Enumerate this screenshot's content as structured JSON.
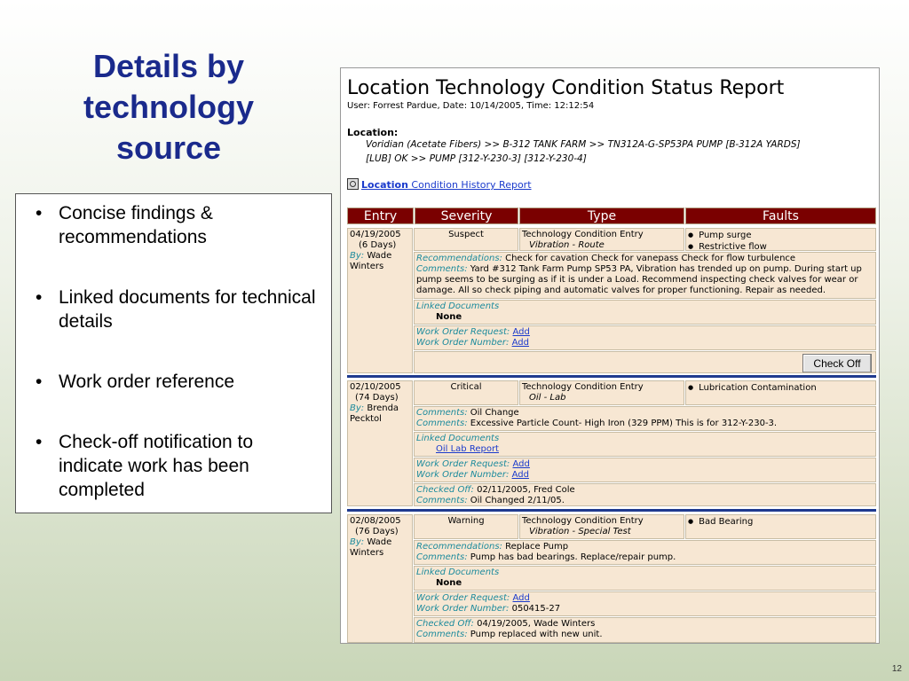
{
  "slide": {
    "title": "Details by technology source",
    "bullets": [
      "Concise findings & recommendations",
      "Linked documents for technical details",
      "Work order reference",
      "Check-off notification to indicate work has been completed"
    ],
    "bullet_symbol": "•",
    "page_number": "12"
  },
  "report": {
    "title": "Location Technology Condition Status Report",
    "user_line": "User: Forrest Pardue, Date: 10/14/2005, Time: 12:12:54",
    "location_label": "Location:",
    "location_line1": "Voridian (Acetate Fibers) >> B-312 TANK FARM >> TN312A-G-SP53PA PUMP [B-312A YARDS]",
    "location_line2": "[LUB] OK >> PUMP [312-Y-230-3] [312-Y-230-4]",
    "history_link_bold": "Location",
    "history_link_rest": " Condition History Report ",
    "headers": {
      "entry": "Entry",
      "severity": "Severity",
      "type": "Type",
      "faults": "Faults"
    },
    "labels": {
      "by": "By:",
      "recommendations": "Recommendations:",
      "comments": "Comments:",
      "linked_documents": "Linked Documents",
      "work_order_request": "Work Order Request:",
      "work_order_number": "Work Order Number:",
      "checked_off": "Checked Off:"
    },
    "check_off_button": "Check Off",
    "entries": [
      {
        "date": "04/19/2005",
        "age": "(6 Days)",
        "by_first": "Wade",
        "by_last": "Winters",
        "severity": "Suspect",
        "type": "Technology Condition Entry",
        "subtype": "Vibration - Route",
        "faults": [
          "Pump surge",
          "Restrictive flow"
        ],
        "recommendations": "Check for cavation Check for vanepass Check for flow turbulence",
        "comments": "Yard #312 Tank Farm Pump SP53 PA, Vibration has trended up on pump. During start up pump seems to be surging as if it is under a Load. Recommend inspecting check valves for wear or damage. All so check piping and automatic valves for proper functioning. Repair as needed.",
        "linked_document": "None",
        "work_order_request": "Add",
        "work_order_number": "Add"
      },
      {
        "date": "02/10/2005",
        "age": "(74 Days)",
        "by_first": "Brenda",
        "by_last": "Pecktol",
        "severity": "Critical",
        "type": "Technology Condition Entry",
        "subtype": "Oil - Lab",
        "faults": [
          "Lubrication Contamination"
        ],
        "recommendations": "Oil Change",
        "comments": "Excessive Particle Count- High Iron (329 PPM) This is for 312-Y-230-3.",
        "linked_document": "Oil Lab Report",
        "work_order_request": "Add",
        "work_order_number": "Add",
        "checked_off": "02/11/2005, Fred Cole",
        "checkoff_comments": "Oil Changed 2/11/05."
      },
      {
        "date": "02/08/2005",
        "age": "(76 Days)",
        "by_first": "Wade",
        "by_last": "Winters",
        "severity": "Warning",
        "type": "Technology Condition Entry",
        "subtype": "Vibration - Special Test",
        "faults": [
          "Bad Bearing"
        ],
        "recommendations": "Replace Pump",
        "comments": "Pump has bad bearings. Replace/repair pump.",
        "linked_document": "None",
        "work_order_request": "Add",
        "work_order_number": "050415-27",
        "checked_off": "04/19/2005, Wade Winters",
        "checkoff_comments": "Pump replaced with new unit."
      }
    ]
  }
}
